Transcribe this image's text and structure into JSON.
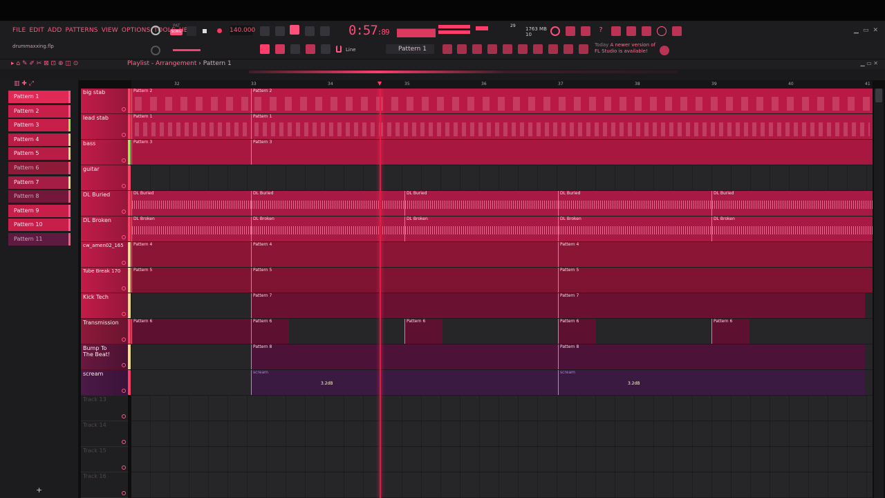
{
  "menu": [
    "FILE",
    "EDIT",
    "ADD",
    "PATTERNS",
    "VIEW",
    "OPTIONS",
    "TOOLS",
    "HELP"
  ],
  "file_name": "drummaxxing.flp",
  "transport": {
    "tempo": "140.000",
    "time_main": "0:57",
    "time_sub": ":89",
    "pat_label": "PAT",
    "song_label": "SONG"
  },
  "memory": {
    "mb": "1763 MB",
    "cpu": "29",
    "polyphony": "10"
  },
  "snap": "Line",
  "pattern_selector": "Pattern 1",
  "news": {
    "line1_dim": "Today",
    "line1": "A newer version of",
    "line2": "FL Studio is available!"
  },
  "playlist": {
    "title": "Playlist - Arrangement",
    "pattern": "Pattern 1"
  },
  "ruler": [
    "32",
    "33",
    "34",
    "35",
    "36",
    "37",
    "38",
    "39",
    "40",
    "41"
  ],
  "patterns": [
    "Pattern 1",
    "Pattern 2",
    "Pattern 3",
    "Pattern 4",
    "Pattern 5",
    "Pattern 6",
    "Pattern 7",
    "Pattern 8",
    "Pattern 9",
    "Pattern 10",
    "Pattern 11"
  ],
  "tracks": [
    "big stab",
    "lead stab",
    "bass",
    "guitar",
    "DL Buried",
    "DL Broken",
    "cw_amen02_165",
    "Tube Break 170",
    "Kick Tech",
    "Transmission",
    "Bump To The Beat!",
    "scream",
    "Track 13",
    "Track 14",
    "Track 15",
    "Track 16"
  ],
  "clips": {
    "big_stab": "Pattern 2",
    "lead_stab": "Pattern 1",
    "bass": "Pattern 3",
    "dl_buried": "DL Buried",
    "dl_broken": "DL Broken",
    "amen": "Pattern 4",
    "tube": "Pattern 5",
    "kick": "Pattern 7",
    "transmission": "Pattern 6",
    "bump": "Pattern 8",
    "scream": "scream",
    "scream_db": "3.2dB"
  },
  "colors": {
    "accent": "#ff3d6b",
    "clip": "#b81a45",
    "playhead": "#e01c45"
  }
}
